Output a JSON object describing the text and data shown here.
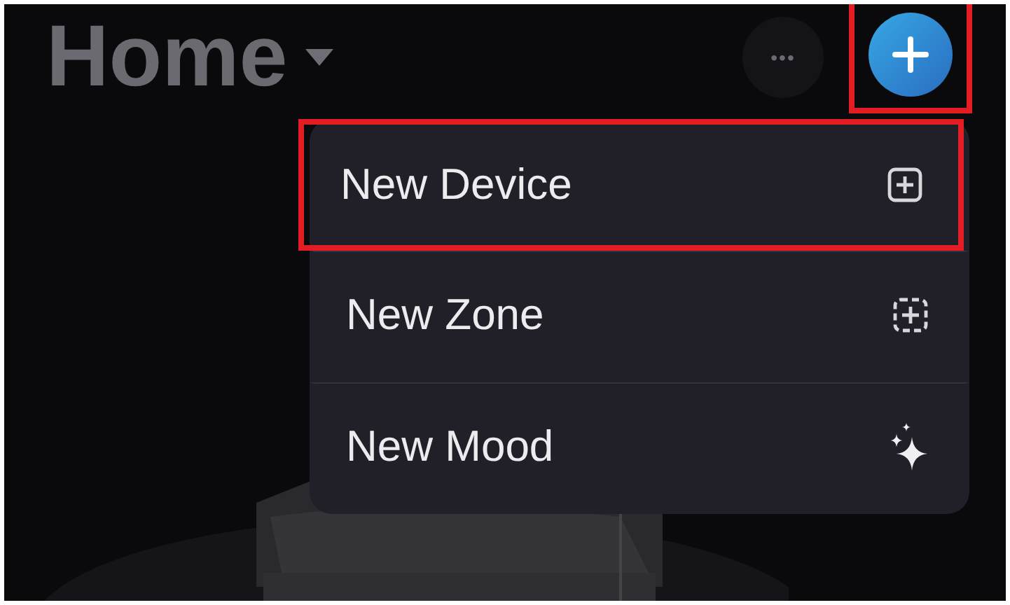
{
  "header": {
    "title": "Home",
    "more_button": {
      "label": "•••"
    },
    "add_button": {
      "highlighted": true
    }
  },
  "menu": {
    "items": [
      {
        "label": "New Device",
        "kind": "device",
        "highlighted": true
      },
      {
        "label": "New Zone",
        "kind": "zone",
        "highlighted": false
      },
      {
        "label": "New Mood",
        "kind": "mood",
        "highlighted": false
      }
    ]
  }
}
